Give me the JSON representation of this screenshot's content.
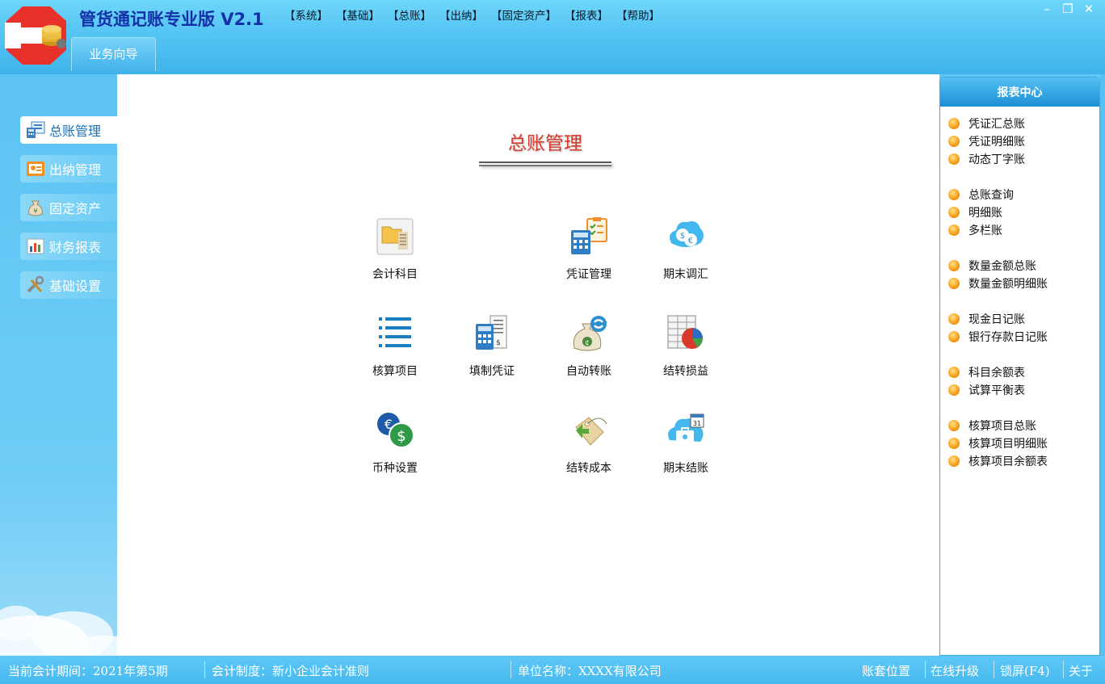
{
  "app": {
    "title": "管货通记账专业版 V2.1",
    "colors": {
      "accent": "#3fb3ea",
      "title_blue": "#1330a8",
      "heading_red": "#d53a2c",
      "bullet": "#f7a11a"
    }
  },
  "menu": [
    "【系统】",
    "【基础】",
    "【总账】",
    "【出纳】",
    "【固定资产】",
    "【报表】",
    "【帮助】"
  ],
  "window_controls": {
    "minimize": "–",
    "restore": "❐",
    "close": "✕"
  },
  "nav": {
    "tab": "业务向导"
  },
  "sidebar": {
    "items": [
      {
        "label": "总账管理",
        "icon": "ledger-calculator-icon",
        "active": true
      },
      {
        "label": "出纳管理",
        "icon": "cashier-card-icon",
        "active": false
      },
      {
        "label": "固定资产",
        "icon": "money-bag-icon",
        "active": false
      },
      {
        "label": "财务报表",
        "icon": "bar-chart-icon",
        "active": false
      },
      {
        "label": "基础设置",
        "icon": "tools-icon",
        "active": false
      }
    ]
  },
  "main": {
    "heading": "总账管理",
    "tiles": [
      {
        "label": "会计科目",
        "icon": "folder-ledger-icon"
      },
      {
        "label": "凭证管理",
        "icon": "voucher-calculator-icon"
      },
      {
        "label": "期末调汇",
        "icon": "currency-exchange-icon"
      },
      {
        "label": "核算项目",
        "icon": "list-icon"
      },
      {
        "label": "填制凭证",
        "icon": "calculator-receipt-icon"
      },
      {
        "label": "自动转账",
        "icon": "money-bag-transfer-icon"
      },
      {
        "label": "结转损益",
        "icon": "pie-sheet-icon"
      },
      {
        "label": "币种设置",
        "icon": "euro-dollar-icon"
      },
      {
        "label": "结转成本",
        "icon": "price-tag-icon"
      },
      {
        "label": "期末结账",
        "icon": "calendar-briefcase-icon"
      }
    ]
  },
  "report_center": {
    "title": "报表中心",
    "groups": [
      [
        "凭证汇总账",
        "凭证明细账",
        "动态丁字账"
      ],
      [
        "总账查询",
        "明细账",
        "多栏账"
      ],
      [
        "数量金额总账",
        "数量金额明细账"
      ],
      [
        "现金日记账",
        "银行存款日记账"
      ],
      [
        "科目余额表",
        "试算平衡表"
      ],
      [
        "核算项目总账",
        "核算项目明细账",
        "核算项目余额表"
      ]
    ]
  },
  "status": {
    "period": "当前会计期间：2021年第5期",
    "system": "会计制度：新小企业会计准则",
    "company": "单位名称：XXXX有限公司",
    "location": "账套位置",
    "upgrade": "在线升级",
    "lock": "锁屏(F4)",
    "about": "关于"
  }
}
